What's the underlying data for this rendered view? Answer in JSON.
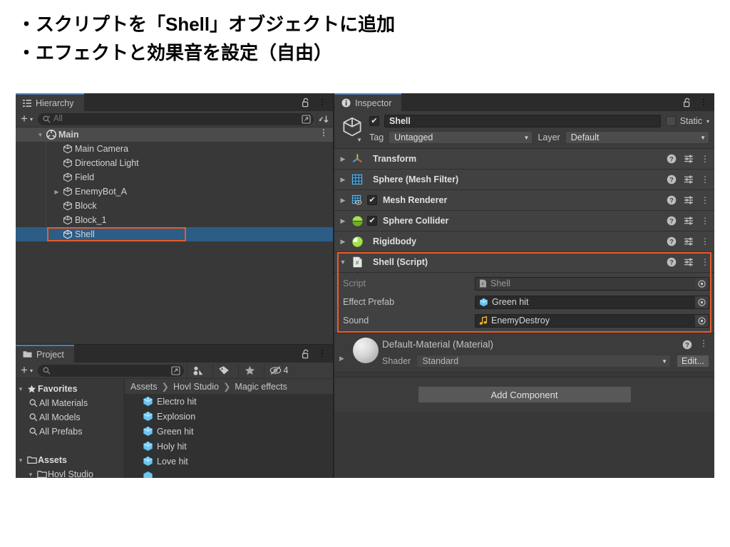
{
  "slide": {
    "heading_lines": [
      "・スクリプトを「Shell」オブジェクトに追加",
      "・エフェクトと効果音を設定（自由）"
    ]
  },
  "colors": {
    "highlight_box": "#ec5a28",
    "selection_blue": "#2c5d87",
    "tab_accent": "#4a7ebb",
    "panel_bg": "#383838",
    "component_bg": "#414141"
  },
  "hierarchy": {
    "tab_label": "Hierarchy",
    "tab_icon": "hierarchy-icon",
    "lock_icon": "lock-open-icon",
    "menu_icon": "kebab-menu-icon",
    "toolbar": {
      "add_label": "+",
      "add_caret": "▾",
      "search_placeholder": "All",
      "search_icon": "search-icon",
      "popout_icon": "popout-icon",
      "sort_icon": "sort-icon"
    },
    "items": [
      {
        "label": "Main",
        "icon": "unity-scene-icon",
        "depth": 0,
        "arrow": "▼",
        "state": "scene",
        "kebab": true
      },
      {
        "label": "Main Camera",
        "icon": "gameobject-icon",
        "depth": 1,
        "arrow": "",
        "state": "normal",
        "kebab": false
      },
      {
        "label": "Directional Light",
        "icon": "gameobject-icon",
        "depth": 1,
        "arrow": "",
        "state": "normal",
        "kebab": false
      },
      {
        "label": "Field",
        "icon": "gameobject-icon",
        "depth": 1,
        "arrow": "",
        "state": "normal",
        "kebab": false
      },
      {
        "label": "EnemyBot_A",
        "icon": "gameobject-icon",
        "depth": 1,
        "arrow": "▶",
        "state": "normal",
        "kebab": false
      },
      {
        "label": "Block",
        "icon": "gameobject-icon",
        "depth": 1,
        "arrow": "",
        "state": "normal",
        "kebab": false
      },
      {
        "label": "Block_1",
        "icon": "gameobject-icon",
        "depth": 1,
        "arrow": "",
        "state": "normal",
        "kebab": false
      },
      {
        "label": "Shell",
        "icon": "gameobject-icon",
        "depth": 1,
        "arrow": "",
        "state": "selected",
        "kebab": false
      }
    ]
  },
  "project": {
    "tab_label": "Project",
    "tab_icon": "folder-icon",
    "lock_icon": "lock-open-icon",
    "menu_icon": "kebab-menu-icon",
    "toolbar": {
      "add_label": "+",
      "add_caret": "▾",
      "search_placeholder": "",
      "search_icon": "search-icon",
      "popout_icon": "popout-icon",
      "shapes_filter_icon": "type-filter-icon",
      "label_filter_icon": "label-filter-icon",
      "favorite_filter_icon": "star-icon",
      "hidden_icon": "eye-off-icon",
      "hidden_count": "4"
    },
    "tree": [
      {
        "label": "Favorites",
        "icon": "star-icon",
        "depth": 0,
        "arrow": "▼",
        "bold": true
      },
      {
        "label": "All Materials",
        "icon": "search-icon",
        "depth": 1,
        "arrow": "",
        "bold": false
      },
      {
        "label": "All Models",
        "icon": "search-icon",
        "depth": 1,
        "arrow": "",
        "bold": false
      },
      {
        "label": "All Prefabs",
        "icon": "search-icon",
        "depth": 1,
        "arrow": "",
        "bold": false
      },
      {
        "label": "",
        "icon": "",
        "depth": 0,
        "arrow": "",
        "bold": false
      },
      {
        "label": "Assets",
        "icon": "folder-icon",
        "depth": 0,
        "arrow": "▼",
        "bold": true
      },
      {
        "label": "Hovl Studio",
        "icon": "folder-icon",
        "depth": 1,
        "arrow": "▼",
        "bold": false
      }
    ],
    "breadcrumb": [
      "Assets",
      "Hovl Studio",
      "Magic effects"
    ],
    "breadcrumb_separator": "❯",
    "assets": [
      {
        "label": "Electro hit",
        "icon": "prefab-icon"
      },
      {
        "label": "Explosion",
        "icon": "prefab-icon"
      },
      {
        "label": "Green hit",
        "icon": "prefab-icon"
      },
      {
        "label": "Holy hit",
        "icon": "prefab-icon"
      },
      {
        "label": "Love hit",
        "icon": "prefab-icon"
      }
    ]
  },
  "inspector": {
    "tab_label": "Inspector",
    "tab_icon": "info-icon",
    "lock_icon": "lock-open-icon",
    "menu_icon": "kebab-menu-icon",
    "object_header": {
      "prefab_icon": "gameobject-icon",
      "enabled_checked": true,
      "name": "Shell",
      "static_label": "Static",
      "static_checked": false,
      "static_caret": "▾",
      "tag_label": "Tag",
      "tag_value": "Untagged",
      "layer_label": "Layer",
      "layer_value": "Default",
      "dropdown_caret": "▼"
    },
    "components": [
      {
        "name": "Transform",
        "icon": "transform-icon",
        "foldout": "▶",
        "has_checkbox": false,
        "checked": false,
        "help": "?",
        "preset": "preset-icon",
        "menu": "kebab-menu-icon"
      },
      {
        "name": "Sphere (Mesh Filter)",
        "icon": "meshfilter-icon",
        "foldout": "▶",
        "has_checkbox": false,
        "checked": false,
        "help": "?",
        "preset": "preset-icon",
        "menu": "kebab-menu-icon"
      },
      {
        "name": "Mesh Renderer",
        "icon": "meshrenderer-icon",
        "foldout": "▶",
        "has_checkbox": true,
        "checked": true,
        "help": "?",
        "preset": "preset-icon",
        "menu": "kebab-menu-icon"
      },
      {
        "name": "Sphere Collider",
        "icon": "collider-icon",
        "foldout": "▶",
        "has_checkbox": true,
        "checked": true,
        "help": "?",
        "preset": "preset-icon",
        "menu": "kebab-menu-icon"
      },
      {
        "name": "Rigidbody",
        "icon": "rigidbody-icon",
        "foldout": "▶",
        "has_checkbox": false,
        "checked": false,
        "help": "?",
        "preset": "preset-icon",
        "menu": "kebab-menu-icon"
      }
    ],
    "script_component": {
      "name": "Shell (Script)",
      "icon": "cs-script-icon",
      "foldout": "▼",
      "help": "?",
      "preset": "preset-icon",
      "menu": "kebab-menu-icon",
      "highlighted": true,
      "properties": [
        {
          "label": "Script",
          "value": "Shell",
          "value_icon": "cs-script-icon",
          "readonly": true,
          "picker": "object-picker-icon"
        },
        {
          "label": "Effect Prefab",
          "value": "Green hit",
          "value_icon": "prefab-icon",
          "readonly": false,
          "picker": "object-picker-icon"
        },
        {
          "label": "Sound",
          "value": "EnemyDestroy",
          "value_icon": "audio-clip-icon",
          "readonly": false,
          "picker": "object-picker-icon"
        }
      ]
    },
    "material": {
      "title": "Default-Material (Material)",
      "foldout": "▶",
      "shader_label": "Shader",
      "shader_value": "Standard",
      "shader_caret": "▼",
      "edit_label": "Edit...",
      "help": "?",
      "menu": "kebab-menu-icon",
      "preview_icon": "material-sphere-preview"
    },
    "add_component_label": "Add Component"
  }
}
